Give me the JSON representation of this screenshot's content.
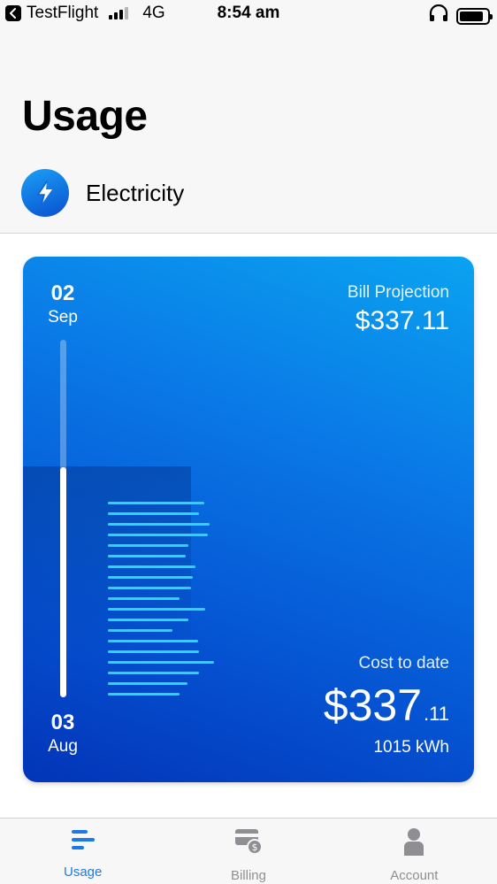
{
  "status_bar": {
    "back_app": "TestFlight",
    "network": "4G",
    "time": "8:54 am"
  },
  "header": {
    "title": "Usage",
    "utility": "Electricity",
    "utility_icon": "lightning-bolt-icon"
  },
  "card": {
    "start_day": "02",
    "start_month": "Sep",
    "end_day": "03",
    "end_month": "Aug",
    "projection_label": "Bill Projection",
    "projection_value": "$337.11",
    "cost_label": "Cost to date",
    "cost_main": "$337",
    "cost_cents": ".11",
    "kwh": "1015 kWh",
    "accent_color": "#2fd3f5"
  },
  "chart_data": {
    "type": "bar",
    "orientation": "horizontal",
    "values": [
      0.75,
      0.71,
      0.79,
      0.78,
      0.63,
      0.61,
      0.68,
      0.66,
      0.65,
      0.56,
      0.76,
      0.63,
      0.5,
      0.7,
      0.71,
      0.83,
      0.71,
      0.62,
      0.56
    ]
  },
  "tabs": [
    {
      "label": "Usage",
      "icon": "usage-icon",
      "active": true
    },
    {
      "label": "Billing",
      "icon": "billing-icon",
      "active": false
    },
    {
      "label": "Account",
      "icon": "account-icon",
      "active": false
    }
  ]
}
